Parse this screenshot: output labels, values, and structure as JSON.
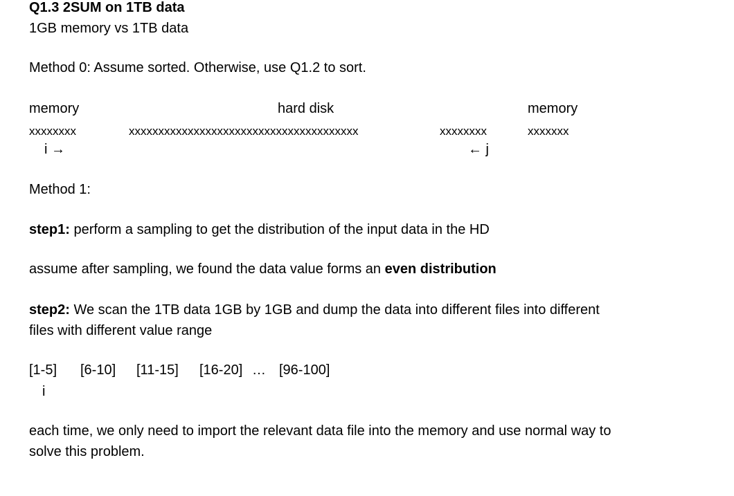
{
  "title": "Q1.3 2SUM on 1TB data",
  "subtitle": "1GB memory vs 1TB data",
  "method0": "Method 0: Assume sorted. Otherwise, use Q1.2 to sort.",
  "diagram": {
    "label_memory_left": "memory",
    "label_hard_disk": "hard disk",
    "label_memory_right": "memory",
    "x_memory_left": "xxxxxxxx",
    "x_hard_disk": "xxxxxxxxxxxxxxxxxxxxxxxxxxxxxxxxxxxxxxx",
    "x_hard_disk_tail": "xxxxxxxx",
    "x_memory_right": "xxxxxxx",
    "pointer_i": "i →",
    "pointer_j": "← j"
  },
  "method1": "Method 1:",
  "step1": {
    "label": "step1:",
    "text": " perform a sampling to get the distribution of the input data in the HD"
  },
  "assume": {
    "text": "assume after sampling, we found the data value forms an ",
    "bold": "even distribution"
  },
  "step2": {
    "label": "step2:",
    "text_line1": " We scan the 1TB data 1GB by 1GB and dump the data into different files into different",
    "text_line2": "files with different value range"
  },
  "ranges": {
    "r1": "[1-5]",
    "r2": "[6-10]",
    "r3": "[11-15]",
    "r4": "[16-20]",
    "ellipsis": "…",
    "r5": "[96-100]",
    "pointer_i": "i"
  },
  "conclusion": {
    "line1": "each time, we only need to import the relevant data file into the memory and use normal way to",
    "line2": "solve this problem."
  }
}
